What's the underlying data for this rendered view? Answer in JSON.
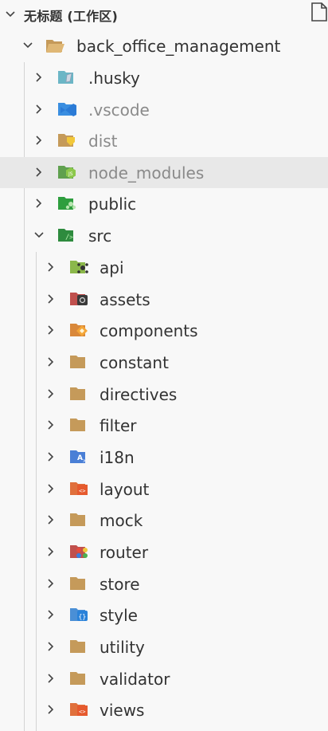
{
  "workspace": {
    "title": "无标题 (工作区)"
  },
  "tree": {
    "root": {
      "label": "back_office_management",
      "expanded": true
    },
    "items": [
      {
        "label": ".husky",
        "icon": "husky-folder-icon",
        "dim": false
      },
      {
        "label": ".vscode",
        "icon": "vscode-folder-icon",
        "dim": true
      },
      {
        "label": "dist",
        "icon": "dist-folder-icon",
        "dim": true
      },
      {
        "label": "node_modules",
        "icon": "nodejs-folder-icon",
        "dim": true,
        "hovered": true
      },
      {
        "label": "public",
        "icon": "public-folder-icon",
        "dim": false
      },
      {
        "label": "src",
        "icon": "src-folder-icon",
        "dim": false,
        "expanded": true
      }
    ],
    "src_children": [
      {
        "label": "api",
        "icon": "api-folder-icon"
      },
      {
        "label": "assets",
        "icon": "assets-folder-icon"
      },
      {
        "label": "components",
        "icon": "components-folder-icon"
      },
      {
        "label": "constant",
        "icon": "folder-icon"
      },
      {
        "label": "directives",
        "icon": "folder-icon"
      },
      {
        "label": "filter",
        "icon": "folder-icon"
      },
      {
        "label": "i18n",
        "icon": "i18n-folder-icon"
      },
      {
        "label": "layout",
        "icon": "layout-folder-icon"
      },
      {
        "label": "mock",
        "icon": "folder-icon"
      },
      {
        "label": "router",
        "icon": "router-folder-icon"
      },
      {
        "label": "store",
        "icon": "folder-icon"
      },
      {
        "label": "style",
        "icon": "style-folder-icon"
      },
      {
        "label": "utility",
        "icon": "folder-icon"
      },
      {
        "label": "validator",
        "icon": "folder-icon"
      },
      {
        "label": "views",
        "icon": "views-folder-icon"
      }
    ]
  },
  "colors": {
    "folder": "#c59a5a",
    "hover": "#e8e8e8",
    "text": "#333333",
    "dim_text": "#8a8a8a"
  }
}
